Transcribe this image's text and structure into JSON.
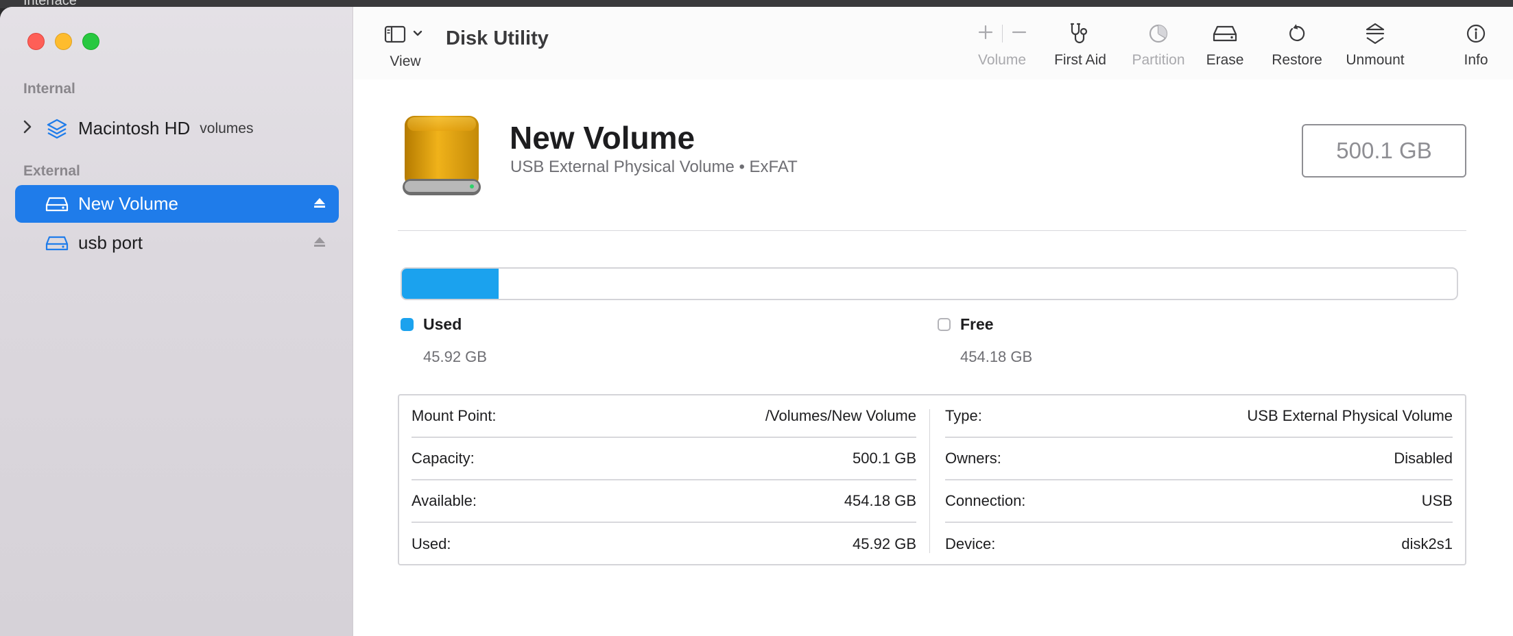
{
  "background": {
    "text": "Interface"
  },
  "sidebar": {
    "sections": {
      "internal": "Internal",
      "external": "External"
    },
    "items": [
      {
        "label": "Macintosh HD",
        "sublabel": "volumes"
      },
      {
        "label": "New Volume"
      },
      {
        "label": "usb port"
      }
    ]
  },
  "toolbar": {
    "view_label": "View",
    "title": "Disk Utility",
    "volume_label": "Volume",
    "first_aid_label": "First Aid",
    "partition_label": "Partition",
    "erase_label": "Erase",
    "restore_label": "Restore",
    "unmount_label": "Unmount",
    "info_label": "Info"
  },
  "volume": {
    "name": "New Volume",
    "description": "USB External Physical Volume • ExFAT",
    "size": "500.1 GB"
  },
  "usage": {
    "used_fraction": 0.0918,
    "used_label": "Used",
    "used_value": "45.92 GB",
    "free_label": "Free",
    "free_value": "454.18 GB",
    "used_color": "#1ba2ee"
  },
  "info": {
    "left": [
      {
        "key": "Mount Point:",
        "value": "/Volumes/New Volume"
      },
      {
        "key": "Capacity:",
        "value": "500.1 GB"
      },
      {
        "key": "Available:",
        "value": "454.18 GB"
      },
      {
        "key": "Used:",
        "value": "45.92 GB"
      }
    ],
    "right": [
      {
        "key": "Type:",
        "value": "USB External Physical Volume"
      },
      {
        "key": "Owners:",
        "value": "Disabled"
      },
      {
        "key": "Connection:",
        "value": "USB"
      },
      {
        "key": "Device:",
        "value": "disk2s1"
      }
    ]
  },
  "colors": {
    "accent": "#1f7cea",
    "usage": "#1ba2ee"
  }
}
